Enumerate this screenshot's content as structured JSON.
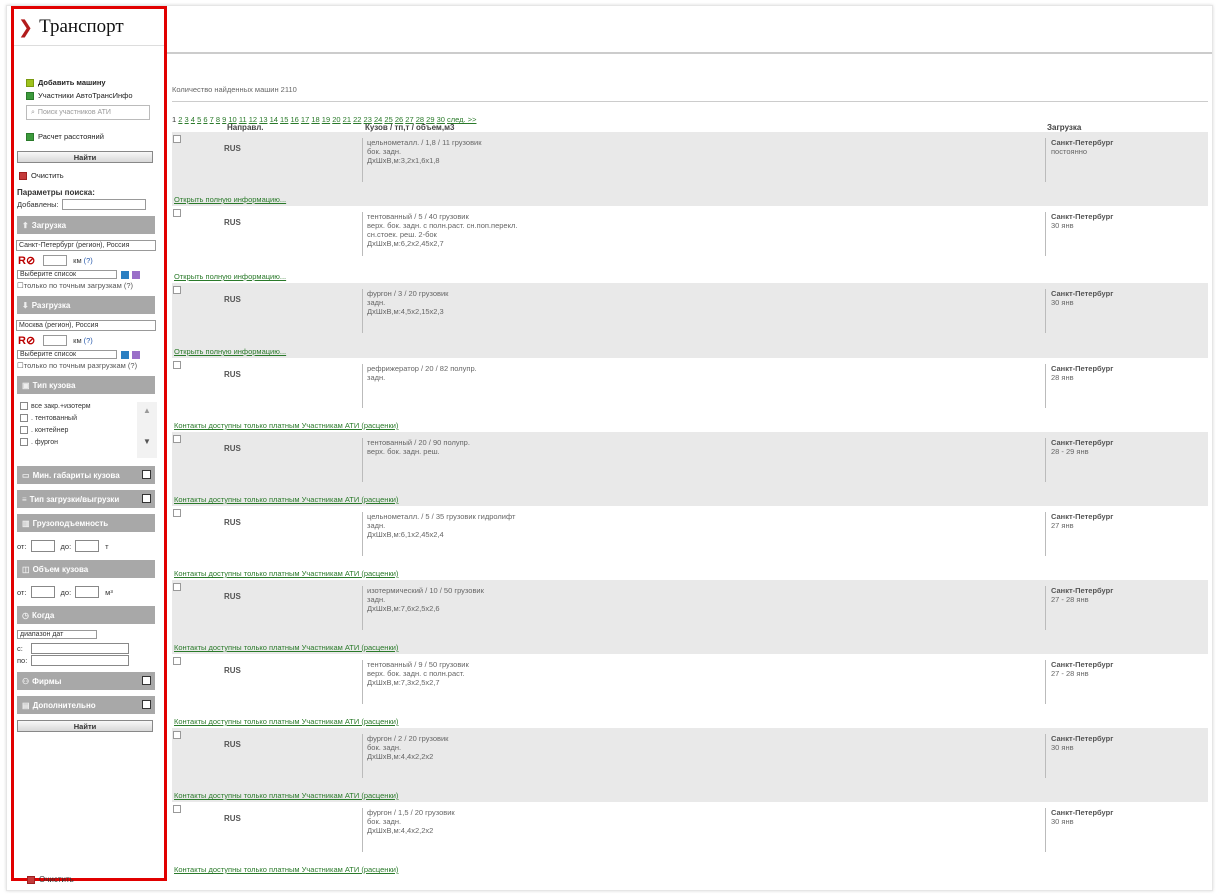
{
  "sidebar": {
    "title": "Транспорт",
    "add_car": "Добавить машину",
    "members": "Участники АвтоТрансИнфо",
    "search_placeholder": "Поиск участников АТИ",
    "distance": "Расчет расстояний",
    "find": "Найти",
    "clear": "Очистить",
    "params": "Параметры поиска:",
    "added": "Добавлены:",
    "loading_section": "Загрузка",
    "loading_address": "Санкт-Петербург (регион), Россия",
    "km": "км",
    "q": "(?)",
    "radius_value": "0",
    "choose_list": "Выберите список",
    "exact_loading": "только по точным загрузкам (?)",
    "unloading_section": "Разгрузка",
    "unloading_address": "Москва (регион), Россия",
    "exact_unloading": "только по точным разгрузкам (?)",
    "body_type_section": "Тип кузова",
    "body_types": [
      "все закр.+изотерм",
      ". тентованный",
      ". контейнер",
      ". фургон"
    ],
    "min_dims_section": "Мин. габариты кузова",
    "load_type_section": "Тип загрузки/выгрузки",
    "capacity_section": "Грузоподъемность",
    "from": "от:",
    "to": "до:",
    "unit_t": "т",
    "volume_section": "Объем кузова",
    "unit_m3": "м³",
    "when_section": "Когда",
    "date_range": "диапазон дат",
    "date_from": "с:",
    "date_to": "по:",
    "firms_section": "Фирмы",
    "extra_section": "Дополнительно"
  },
  "main": {
    "count_text": "Количество найденных машин 2110",
    "pages_current": "1",
    "pages": [
      "2",
      "3",
      "4",
      "5",
      "6",
      "7",
      "8",
      "9",
      "10",
      "11",
      "12",
      "13",
      "14",
      "15",
      "16",
      "17",
      "18",
      "19",
      "20",
      "21",
      "22",
      "23",
      "24",
      "25",
      "26",
      "27",
      "28",
      "29",
      "30"
    ],
    "next": "след. >>",
    "col_direction": "Направл.",
    "col_body": "Кузов / тп,т / объем,м3",
    "col_loading": "Загрузка",
    "rows": [
      {
        "dir": "RUS",
        "body": [
          "цельнометалл. / 1,8 / 11 грузовик",
          "бок. задн.",
          "ДхШхВ,м:3,2x1,6x1,8"
        ],
        "city": "Санкт-Петербург",
        "date": "постоянно",
        "link": "Открыть полную информацию...",
        "gray": true
      },
      {
        "dir": "RUS",
        "body": [
          "тентованный / 5 / 40 грузовик",
          "верх. бок. задн. с полн.раст. сн.поп.перекл.",
          "сн.стоек. реш. 2-бок",
          "ДхШхВ,м:6,2x2,45x2,7"
        ],
        "city": "Санкт-Петербург",
        "date": "30 янв",
        "link": "Открыть полную информацию...",
        "gray": false
      },
      {
        "dir": "RUS",
        "body": [
          "фургон / 3 / 20 грузовик",
          "задн.",
          "ДхШхВ,м:4,5x2,15x2,3"
        ],
        "city": "Санкт-Петербург",
        "date": "30 янв",
        "link": "Открыть полную информацию...",
        "gray": true
      },
      {
        "dir": "RUS",
        "body": [
          "рефрижератор / 20 / 82 полупр.",
          "задн."
        ],
        "city": "Санкт-Петербург",
        "date": "28 янв",
        "link": "Контакты доступны только платным Участникам АТИ (расценки)",
        "gray": false
      },
      {
        "dir": "RUS",
        "body": [
          "тентованный / 20 / 90 полупр.",
          "верх. бок. задн. реш."
        ],
        "city": "Санкт-Петербург",
        "date": "28 - 29 янв",
        "link": "Контакты доступны только платным Участникам АТИ (расценки)",
        "gray": true
      },
      {
        "dir": "RUS",
        "body": [
          "цельнометалл. / 5 / 35 грузовик гидролифт",
          "задн.",
          "ДхШхВ,м:6,1x2,45x2,4"
        ],
        "city": "Санкт-Петербург",
        "date": "27 янв",
        "link": "Контакты доступны только платным Участникам АТИ (расценки)",
        "gray": false
      },
      {
        "dir": "RUS",
        "body": [
          "изотермический / 10 / 50 грузовик",
          "задн.",
          "ДхШхВ,м:7,6x2,5x2,6"
        ],
        "city": "Санкт-Петербург",
        "date": "27 - 28 янв",
        "link": "Контакты доступны только платным Участникам АТИ (расценки)",
        "gray": true
      },
      {
        "dir": "RUS",
        "body": [
          "тентованный / 9 / 50 грузовик",
          "верх. бок. задн. с полн.раст.",
          "ДхШхВ,м:7,3x2,5x2,7"
        ],
        "city": "Санкт-Петербург",
        "date": "27 - 28 янв",
        "link": "Контакты доступны только платным Участникам АТИ (расценки)",
        "gray": false
      },
      {
        "dir": "RUS",
        "body": [
          "фургон / 2 / 20 грузовик",
          "бок. задн.",
          "ДхШхВ,м:4,4x2,2x2"
        ],
        "city": "Санкт-Петербург",
        "date": "30 янв",
        "link": "Контакты доступны только платным Участникам АТИ (расценки)",
        "gray": true
      },
      {
        "dir": "RUS",
        "body": [
          "фургон / 1,5 / 20 грузовик",
          "бок. задн.",
          "ДхШхВ,м:4,4x2,2x2"
        ],
        "city": "Санкт-Петербург",
        "date": "30 янв",
        "link": "Контакты доступны только платным Участникам АТИ (расценки)",
        "gray": false
      }
    ]
  }
}
